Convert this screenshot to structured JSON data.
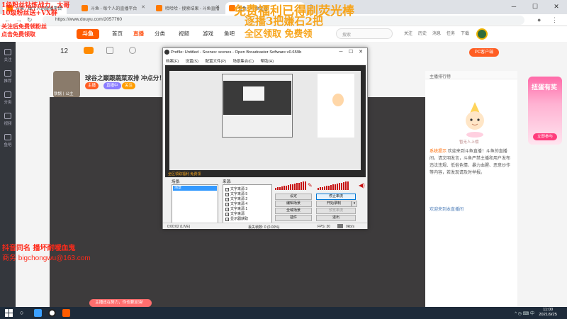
{
  "browser": {
    "tabs": [
      {
        "title": "斗鱼 - 每个人的直播平台"
      },
      {
        "title": "哈哈哈 - 搜索结果 - 斗鱼直播"
      },
      {
        "title": "斗鱼直播 - 斗鱼直播"
      },
      {
        "title": "兔兔 - 斗鱼直播"
      }
    ],
    "url": "https://www.douyu.com/2057760",
    "controls": {
      "min": "─",
      "max": "☐",
      "close": "✕"
    }
  },
  "site": {
    "logo": "斗鱼",
    "nav": [
      "首页",
      "直播",
      "分类",
      "视频",
      "游戏",
      "鱼吧"
    ],
    "nav_active": 1,
    "search_placeholder": "搜索",
    "header_icons": [
      "关注",
      "历史",
      "消息",
      "任务",
      "下载"
    ]
  },
  "sidebar": {
    "items": [
      "关注",
      "推荐",
      "分类",
      "视频",
      "鱼吧"
    ]
  },
  "room": {
    "viewer_count": "12",
    "title": "球谷之巅跟蔬菜双排 冲点分！",
    "tags": [
      "主播",
      "直播中",
      "关注"
    ],
    "streamer": "铁锅丨公主",
    "pc_button": "PC客户端"
  },
  "overlays": {
    "top_left_1": "1级粉丝钻炼战力，大哥",
    "top_left_2": "10级粉丝送+VX群",
    "top_left_3": "关注后免费领粉丝",
    "top_left_4": "点击免费领取",
    "center_1": "免费福利已得刷荧光棒",
    "center_2": "逐播3把嫌石2把",
    "center_3": "全区领取 免费领",
    "promo_1": "抖音同名 播坏耐嗳血鬼",
    "promo_2": "商务 bigchongwu@163.com"
  },
  "obs": {
    "title": "Profile: Untitled - Scenes: scenes - Open Broadcaster Software v0.659b",
    "menu": [
      "档案(F)",
      "设置(S)",
      "配置文件(P)",
      "场景集合(C)",
      "帮助(H)"
    ],
    "scenes_label": "场景:",
    "scene_item": "场景",
    "sources_label": "来源:",
    "sources": [
      "文字来源 3",
      "文字来源 5",
      "文字来源 2",
      "文字来源 4",
      "文字来源 1",
      "文字来源",
      "显示器获取"
    ],
    "buttons": {
      "settings": "设定",
      "stop_stream": "停止串流",
      "edit_scene": "编辑场景",
      "start_record": "开始录制",
      "fullscreen_preview": "全域场景",
      "preview_stream": "预览串流",
      "plugins": "插件",
      "exit": "退出"
    },
    "preview_caption": "全区领取福利 免费领",
    "status": {
      "time": "0:00:02 (LIVE)",
      "dropped": "丢失帧数: 0 (0.00%)",
      "fps": "FPS: 30",
      "bitrate": "0kb/s"
    }
  },
  "chat": {
    "header": "主播排行榜",
    "mascot_caption": "暂无人上榜",
    "system_label": "系统提示",
    "system_message": "欢迎来到斗鱼直播！斗鱼的直播间，请文明发言，斗鱼严禁主播和用户发布违法违规、低俗色情、暴力血腥、恶意炒作等内容，若发现请及时举报。",
    "msg2": "欢迎来到本直播间"
  },
  "ad": {
    "title": "扭蛋有奖",
    "button": "立即参与"
  },
  "toast": "主播还在努力，你也要加油！",
  "taskbar": {
    "time": "11:00",
    "date": "2021/9/25",
    "tray": "^ ◷ ⌨ 中"
  }
}
